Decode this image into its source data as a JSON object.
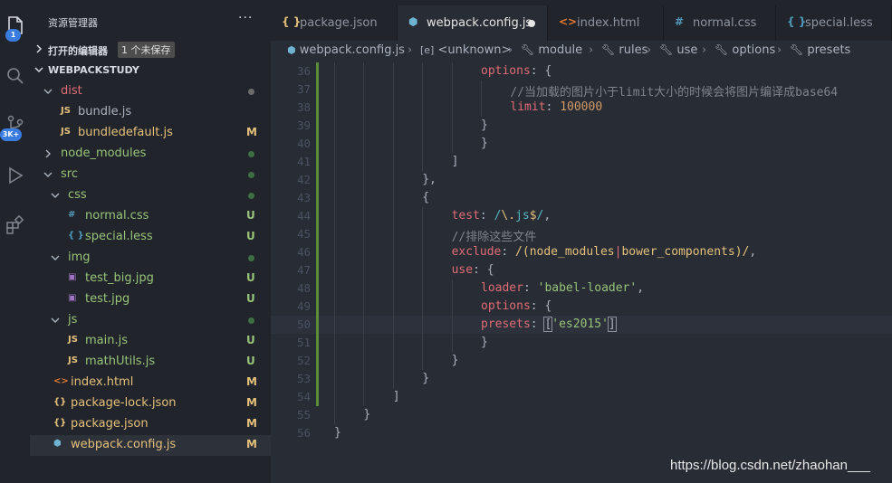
{
  "activity_bar": {
    "explorer_badge": "1",
    "scm_badge": "3K+"
  },
  "sidebar": {
    "title": "资源管理器",
    "more": "···",
    "open_editors_label": "打开的编辑器",
    "unsaved_badge": "1 个未保存",
    "project_label": "WEBPACKSTUDY",
    "tree": [
      {
        "label": "dist",
        "type": "folder",
        "open": true,
        "depth": 0,
        "status": "dot",
        "color": "#e06c75",
        "dot_color": "#6b6b6b"
      },
      {
        "label": "bundle.js",
        "type": "js",
        "depth": 1,
        "status": "",
        "color": "#abb2bf"
      },
      {
        "label": "bundledefault.js",
        "type": "js",
        "depth": 1,
        "status": "M",
        "color": "#e5c07b",
        "status_color": "#e5c07b"
      },
      {
        "label": "node_modules",
        "type": "folder",
        "open": false,
        "depth": 0,
        "status": "dot",
        "color": "#98c379",
        "dot_color": "#3f6e45"
      },
      {
        "label": "src",
        "type": "folder",
        "open": true,
        "depth": 0,
        "status": "dot",
        "color": "#98c379",
        "dot_color": "#3f6e45"
      },
      {
        "label": "css",
        "type": "folder",
        "open": true,
        "depth": 1,
        "status": "dot",
        "color": "#98c379",
        "dot_color": "#3f6e45"
      },
      {
        "label": "normal.css",
        "type": "css",
        "depth": 2,
        "status": "U",
        "color": "#98c379",
        "status_color": "#98c379"
      },
      {
        "label": "special.less",
        "type": "less",
        "depth": 2,
        "status": "U",
        "color": "#98c379",
        "status_color": "#98c379"
      },
      {
        "label": "img",
        "type": "folder",
        "open": true,
        "depth": 1,
        "status": "dot",
        "color": "#98c379",
        "dot_color": "#3f6e45"
      },
      {
        "label": "test_big.jpg",
        "type": "img",
        "depth": 2,
        "status": "U",
        "color": "#98c379",
        "status_color": "#98c379"
      },
      {
        "label": "test.jpg",
        "type": "img",
        "depth": 2,
        "status": "U",
        "color": "#98c379",
        "status_color": "#98c379"
      },
      {
        "label": "js",
        "type": "folder",
        "open": true,
        "depth": 1,
        "status": "dot",
        "color": "#98c379",
        "dot_color": "#3f6e45"
      },
      {
        "label": "main.js",
        "type": "js",
        "depth": 2,
        "status": "U",
        "color": "#98c379",
        "status_color": "#98c379"
      },
      {
        "label": "mathUtils.js",
        "type": "js",
        "depth": 2,
        "status": "U",
        "color": "#98c379",
        "status_color": "#98c379"
      },
      {
        "label": "index.html",
        "type": "html",
        "depth": 0,
        "status": "M",
        "color": "#e5c07b",
        "status_color": "#e5c07b"
      },
      {
        "label": "package-lock.json",
        "type": "json",
        "depth": 0,
        "status": "M",
        "color": "#e5c07b",
        "status_color": "#e5c07b"
      },
      {
        "label": "package.json",
        "type": "json",
        "depth": 0,
        "status": "M",
        "color": "#e5c07b",
        "status_color": "#e5c07b"
      },
      {
        "label": "webpack.config.js",
        "type": "webpack",
        "depth": 0,
        "status": "M",
        "color": "#e5c07b",
        "status_color": "#e5c07b",
        "active": true
      }
    ]
  },
  "tabs": [
    {
      "label": "package.json",
      "icon": "{ }",
      "icon_color": "#e5c07b",
      "active": false
    },
    {
      "label": "webpack.config.js",
      "icon": "⬢",
      "icon_color": "#6fb3d2",
      "active": true,
      "dirty": true
    },
    {
      "label": "index.html",
      "icon": "<>",
      "icon_color": "#e37933",
      "active": false
    },
    {
      "label": "normal.css",
      "icon": "#",
      "icon_color": "#519aba",
      "active": false
    },
    {
      "label": "special.less",
      "icon": "{ }",
      "icon_color": "#519aba",
      "active": false
    }
  ],
  "breadcrumb": [
    "webpack.config.js",
    "<unknown>",
    "module",
    "rules",
    "use",
    "options",
    "presets"
  ],
  "editor": {
    "current_line": 50,
    "lines": [
      {
        "n": "36",
        "indent": 5,
        "gutter": true,
        "tokens": [
          [
            "options",
            "k"
          ],
          [
            ": {",
            "p"
          ]
        ]
      },
      {
        "n": "37",
        "indent": 6,
        "gutter": true,
        "tokens": [
          [
            "//当加载的图片小于limit大小的时候会将图片编译成base64",
            "c"
          ]
        ]
      },
      {
        "n": "38",
        "indent": 6,
        "gutter": true,
        "tokens": [
          [
            "limit",
            "k"
          ],
          [
            ": ",
            "p"
          ],
          [
            "100000",
            "n"
          ]
        ]
      },
      {
        "n": "39",
        "indent": 5,
        "gutter": true,
        "tokens": [
          [
            "}",
            "p"
          ]
        ]
      },
      {
        "n": "40",
        "indent": 5,
        "gutter": true,
        "tokens": [
          [
            "}",
            "p"
          ]
        ]
      },
      {
        "n": "41",
        "indent": 4,
        "gutter": true,
        "tokens": [
          [
            "]",
            "p"
          ]
        ]
      },
      {
        "n": "42",
        "indent": 3,
        "gutter": true,
        "tokens": [
          [
            "},",
            "p"
          ]
        ]
      },
      {
        "n": "43",
        "indent": 3,
        "gutter": true,
        "tokens": [
          [
            "{",
            "p"
          ]
        ]
      },
      {
        "n": "44",
        "indent": 4,
        "gutter": true,
        "tokens": [
          [
            "test",
            "k"
          ],
          [
            ": ",
            "p"
          ],
          [
            "/",
            "re"
          ],
          [
            "\\.",
            "r"
          ],
          [
            "js",
            "re"
          ],
          [
            "$",
            "r"
          ],
          [
            "/",
            "re"
          ],
          [
            ",",
            "p"
          ]
        ]
      },
      {
        "n": "45",
        "indent": 4,
        "gutter": true,
        "tokens": [
          [
            "//排除这些文件",
            "c"
          ]
        ]
      },
      {
        "n": "46",
        "indent": 4,
        "gutter": true,
        "tokens": [
          [
            "exclude",
            "k"
          ],
          [
            ": ",
            "p"
          ],
          [
            "/(",
            "r"
          ],
          [
            "node_modules",
            "r"
          ],
          [
            "|",
            "k"
          ],
          [
            "bower_components",
            "r"
          ],
          [
            ")/",
            "r"
          ],
          [
            ",",
            "p"
          ]
        ]
      },
      {
        "n": "47",
        "indent": 4,
        "gutter": true,
        "tokens": [
          [
            "use",
            "k"
          ],
          [
            ": {",
            "p"
          ]
        ]
      },
      {
        "n": "48",
        "indent": 5,
        "gutter": true,
        "tokens": [
          [
            "loader",
            "k"
          ],
          [
            ": ",
            "p"
          ],
          [
            "'babel-loader'",
            "s"
          ],
          [
            ",",
            "p"
          ]
        ]
      },
      {
        "n": "49",
        "indent": 5,
        "gutter": true,
        "tokens": [
          [
            "options",
            "k"
          ],
          [
            ": {",
            "p"
          ]
        ]
      },
      {
        "n": "50",
        "indent": 5,
        "gutter": true,
        "tokens": [
          [
            "presets",
            "k"
          ],
          [
            ": ",
            "p"
          ],
          [
            "[",
            "bm"
          ],
          [
            "'es2015'",
            "s"
          ],
          [
            "]",
            "bm"
          ]
        ]
      },
      {
        "n": "51",
        "indent": 5,
        "gutter": true,
        "tokens": [
          [
            "}",
            "p"
          ]
        ]
      },
      {
        "n": "52",
        "indent": 4,
        "gutter": true,
        "tokens": [
          [
            "}",
            "p"
          ]
        ]
      },
      {
        "n": "53",
        "indent": 3,
        "gutter": true,
        "tokens": [
          [
            "}",
            "p"
          ]
        ]
      },
      {
        "n": "54",
        "indent": 2,
        "gutter": true,
        "tokens": [
          [
            "]",
            "p"
          ]
        ]
      },
      {
        "n": "55",
        "indent": 1,
        "gutter": false,
        "tokens": [
          [
            "}",
            "p"
          ]
        ]
      },
      {
        "n": "56",
        "indent": 0,
        "gutter": false,
        "tokens": [
          [
            "}",
            "p"
          ]
        ]
      }
    ]
  },
  "watermark": "https://blog.csdn.net/zhaohan___"
}
